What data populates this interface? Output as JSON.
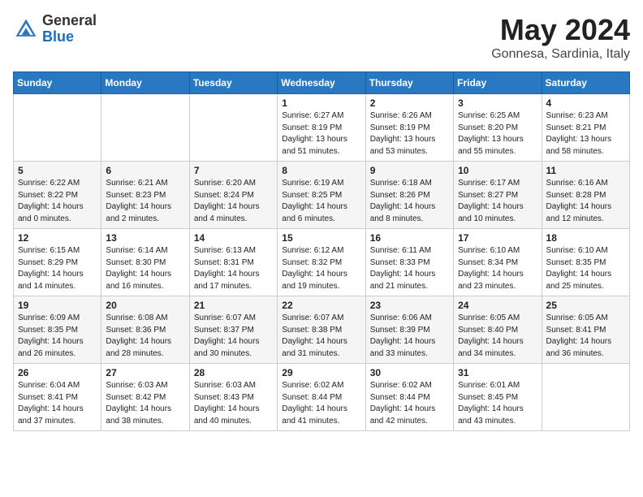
{
  "header": {
    "logo_general": "General",
    "logo_blue": "Blue",
    "month": "May 2024",
    "location": "Gonnesa, Sardinia, Italy"
  },
  "days_of_week": [
    "Sunday",
    "Monday",
    "Tuesday",
    "Wednesday",
    "Thursday",
    "Friday",
    "Saturday"
  ],
  "weeks": [
    [
      {
        "day": "",
        "info": ""
      },
      {
        "day": "",
        "info": ""
      },
      {
        "day": "",
        "info": ""
      },
      {
        "day": "1",
        "info": "Sunrise: 6:27 AM\nSunset: 8:19 PM\nDaylight: 13 hours\nand 51 minutes."
      },
      {
        "day": "2",
        "info": "Sunrise: 6:26 AM\nSunset: 8:19 PM\nDaylight: 13 hours\nand 53 minutes."
      },
      {
        "day": "3",
        "info": "Sunrise: 6:25 AM\nSunset: 8:20 PM\nDaylight: 13 hours\nand 55 minutes."
      },
      {
        "day": "4",
        "info": "Sunrise: 6:23 AM\nSunset: 8:21 PM\nDaylight: 13 hours\nand 58 minutes."
      }
    ],
    [
      {
        "day": "5",
        "info": "Sunrise: 6:22 AM\nSunset: 8:22 PM\nDaylight: 14 hours\nand 0 minutes."
      },
      {
        "day": "6",
        "info": "Sunrise: 6:21 AM\nSunset: 8:23 PM\nDaylight: 14 hours\nand 2 minutes."
      },
      {
        "day": "7",
        "info": "Sunrise: 6:20 AM\nSunset: 8:24 PM\nDaylight: 14 hours\nand 4 minutes."
      },
      {
        "day": "8",
        "info": "Sunrise: 6:19 AM\nSunset: 8:25 PM\nDaylight: 14 hours\nand 6 minutes."
      },
      {
        "day": "9",
        "info": "Sunrise: 6:18 AM\nSunset: 8:26 PM\nDaylight: 14 hours\nand 8 minutes."
      },
      {
        "day": "10",
        "info": "Sunrise: 6:17 AM\nSunset: 8:27 PM\nDaylight: 14 hours\nand 10 minutes."
      },
      {
        "day": "11",
        "info": "Sunrise: 6:16 AM\nSunset: 8:28 PM\nDaylight: 14 hours\nand 12 minutes."
      }
    ],
    [
      {
        "day": "12",
        "info": "Sunrise: 6:15 AM\nSunset: 8:29 PM\nDaylight: 14 hours\nand 14 minutes."
      },
      {
        "day": "13",
        "info": "Sunrise: 6:14 AM\nSunset: 8:30 PM\nDaylight: 14 hours\nand 16 minutes."
      },
      {
        "day": "14",
        "info": "Sunrise: 6:13 AM\nSunset: 8:31 PM\nDaylight: 14 hours\nand 17 minutes."
      },
      {
        "day": "15",
        "info": "Sunrise: 6:12 AM\nSunset: 8:32 PM\nDaylight: 14 hours\nand 19 minutes."
      },
      {
        "day": "16",
        "info": "Sunrise: 6:11 AM\nSunset: 8:33 PM\nDaylight: 14 hours\nand 21 minutes."
      },
      {
        "day": "17",
        "info": "Sunrise: 6:10 AM\nSunset: 8:34 PM\nDaylight: 14 hours\nand 23 minutes."
      },
      {
        "day": "18",
        "info": "Sunrise: 6:10 AM\nSunset: 8:35 PM\nDaylight: 14 hours\nand 25 minutes."
      }
    ],
    [
      {
        "day": "19",
        "info": "Sunrise: 6:09 AM\nSunset: 8:35 PM\nDaylight: 14 hours\nand 26 minutes."
      },
      {
        "day": "20",
        "info": "Sunrise: 6:08 AM\nSunset: 8:36 PM\nDaylight: 14 hours\nand 28 minutes."
      },
      {
        "day": "21",
        "info": "Sunrise: 6:07 AM\nSunset: 8:37 PM\nDaylight: 14 hours\nand 30 minutes."
      },
      {
        "day": "22",
        "info": "Sunrise: 6:07 AM\nSunset: 8:38 PM\nDaylight: 14 hours\nand 31 minutes."
      },
      {
        "day": "23",
        "info": "Sunrise: 6:06 AM\nSunset: 8:39 PM\nDaylight: 14 hours\nand 33 minutes."
      },
      {
        "day": "24",
        "info": "Sunrise: 6:05 AM\nSunset: 8:40 PM\nDaylight: 14 hours\nand 34 minutes."
      },
      {
        "day": "25",
        "info": "Sunrise: 6:05 AM\nSunset: 8:41 PM\nDaylight: 14 hours\nand 36 minutes."
      }
    ],
    [
      {
        "day": "26",
        "info": "Sunrise: 6:04 AM\nSunset: 8:41 PM\nDaylight: 14 hours\nand 37 minutes."
      },
      {
        "day": "27",
        "info": "Sunrise: 6:03 AM\nSunset: 8:42 PM\nDaylight: 14 hours\nand 38 minutes."
      },
      {
        "day": "28",
        "info": "Sunrise: 6:03 AM\nSunset: 8:43 PM\nDaylight: 14 hours\nand 40 minutes."
      },
      {
        "day": "29",
        "info": "Sunrise: 6:02 AM\nSunset: 8:44 PM\nDaylight: 14 hours\nand 41 minutes."
      },
      {
        "day": "30",
        "info": "Sunrise: 6:02 AM\nSunset: 8:44 PM\nDaylight: 14 hours\nand 42 minutes."
      },
      {
        "day": "31",
        "info": "Sunrise: 6:01 AM\nSunset: 8:45 PM\nDaylight: 14 hours\nand 43 minutes."
      },
      {
        "day": "",
        "info": ""
      }
    ]
  ]
}
